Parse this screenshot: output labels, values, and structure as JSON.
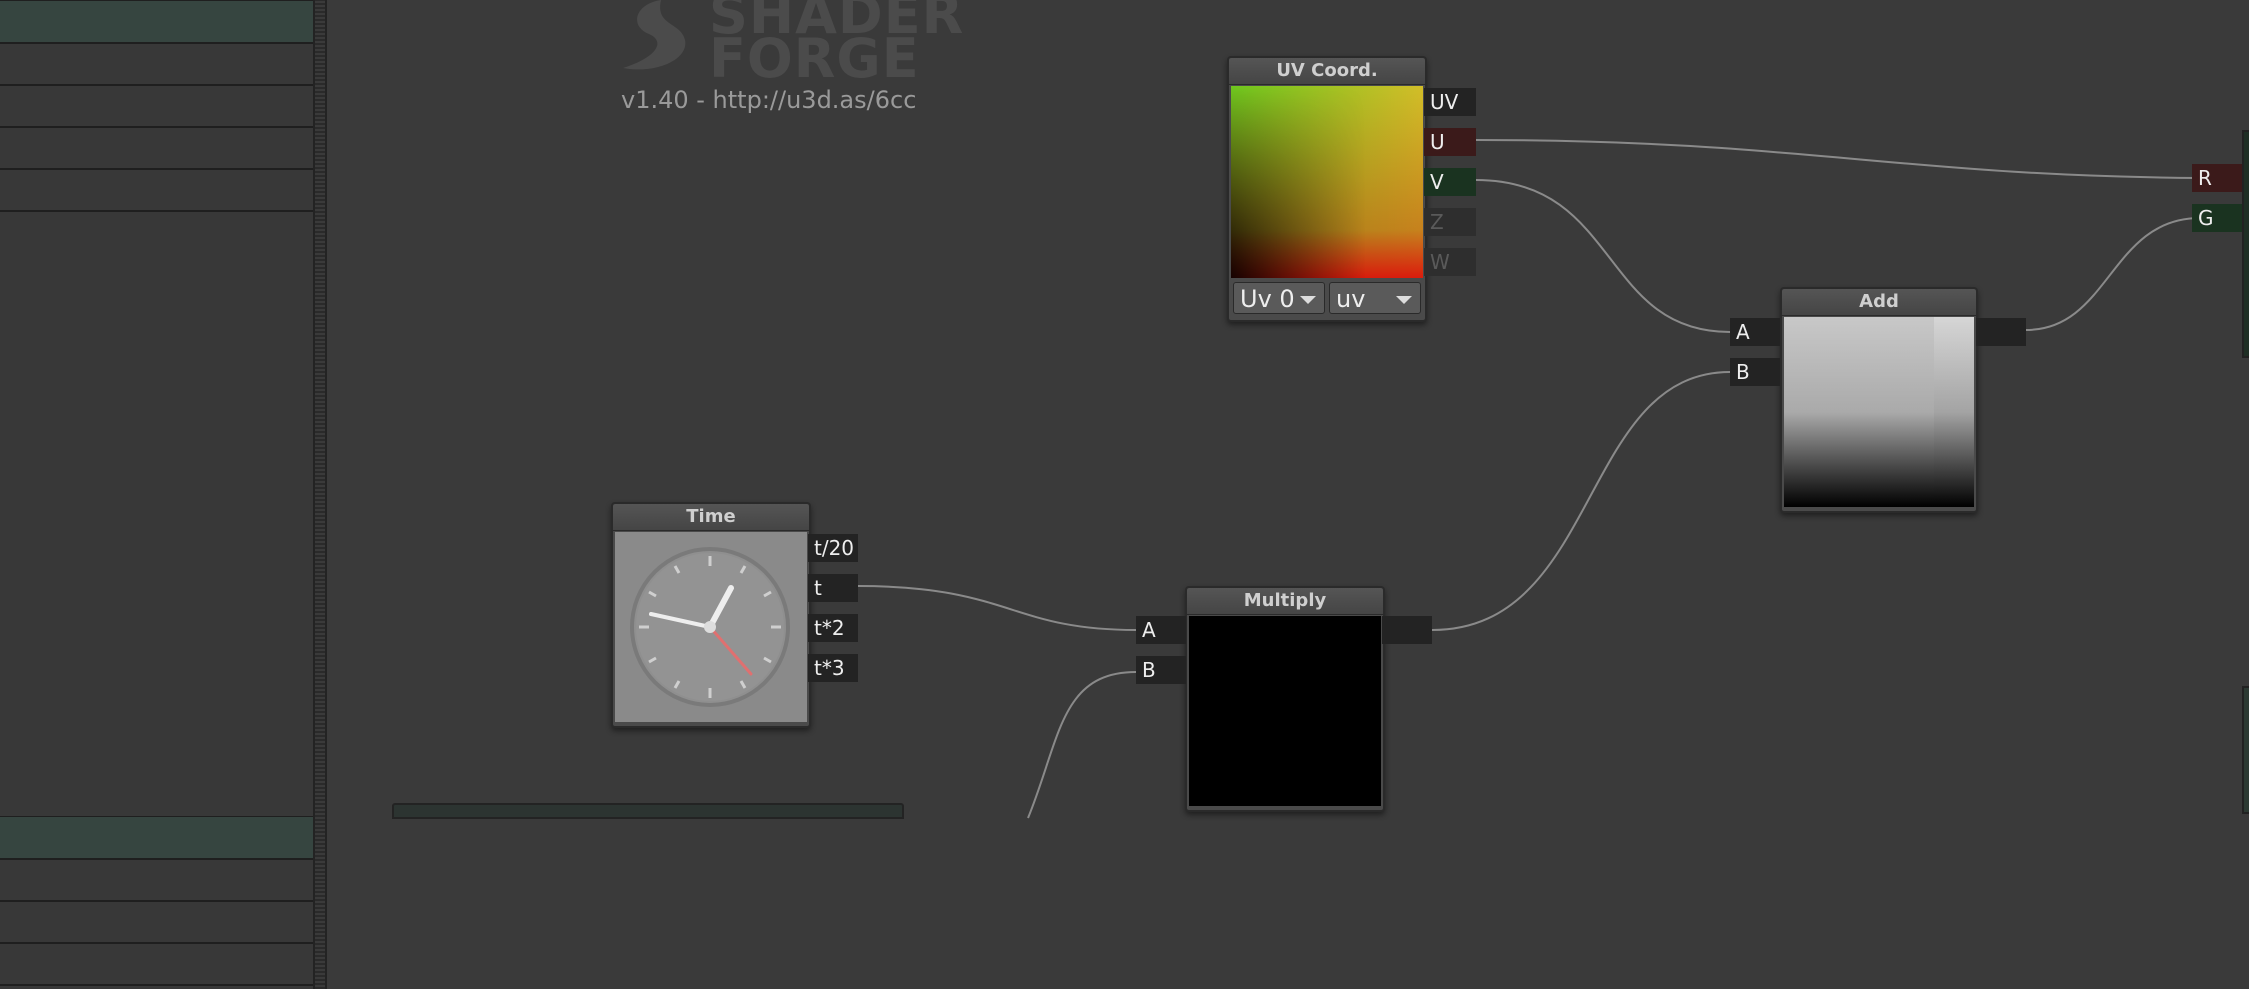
{
  "logo": {
    "line1": "SHADER",
    "line2": "FORGE",
    "version": "v1.40 - http://u3d.as/6cc"
  },
  "nodes": {
    "uv_coord": {
      "title": "UV Coord.",
      "outputs": [
        "UV",
        "U",
        "V",
        "Z",
        "W"
      ],
      "uv_channel": "Uv 0",
      "uv_mode": "uv"
    },
    "add": {
      "title": "Add",
      "inputs": [
        "A",
        "B"
      ]
    },
    "time": {
      "title": "Time",
      "outputs": [
        "t/20",
        "t",
        "t*2",
        "t*3"
      ]
    },
    "multiply": {
      "title": "Multiply",
      "inputs": [
        "A",
        "B"
      ]
    },
    "offscreen": {
      "inputs": [
        "R",
        "G"
      ]
    }
  },
  "colors": {
    "canvas": "#3a3a3a",
    "sidebar_highlight": "#364540",
    "wire": "#8a8a8a",
    "port_red": "#3b1a1a",
    "port_green": "#1a3320"
  }
}
